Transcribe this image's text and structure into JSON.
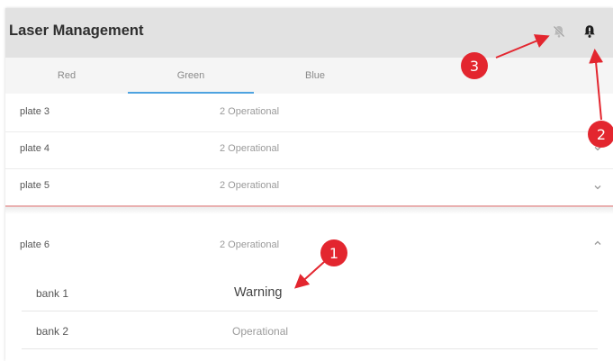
{
  "header": {
    "title": "Laser Management"
  },
  "icons": {
    "notifications_off": "bell-off-icon",
    "alert": "alert-icon"
  },
  "tabs": [
    {
      "label": "Red",
      "active": false
    },
    {
      "label": "Green",
      "active": true
    },
    {
      "label": "Blue",
      "active": false
    }
  ],
  "plates": [
    {
      "label": "plate 3",
      "status": "2 Operational"
    },
    {
      "label": "plate 4",
      "status": "2 Operational",
      "chevron": "down"
    },
    {
      "label": "plate 5",
      "status": "2 Operational",
      "chevron": "down"
    },
    {
      "label": "plate 6",
      "status": "2 Operational",
      "chevron": "up"
    }
  ],
  "banks": [
    {
      "label": "bank 1",
      "status": "Warning"
    },
    {
      "label": "bank 2",
      "status": "Operational"
    }
  ],
  "callouts": [
    "1",
    "2",
    "3"
  ],
  "colors": {
    "accent": "#4ea3e0",
    "callout": "#e3262f",
    "header_bg": "#e2e2e2"
  }
}
